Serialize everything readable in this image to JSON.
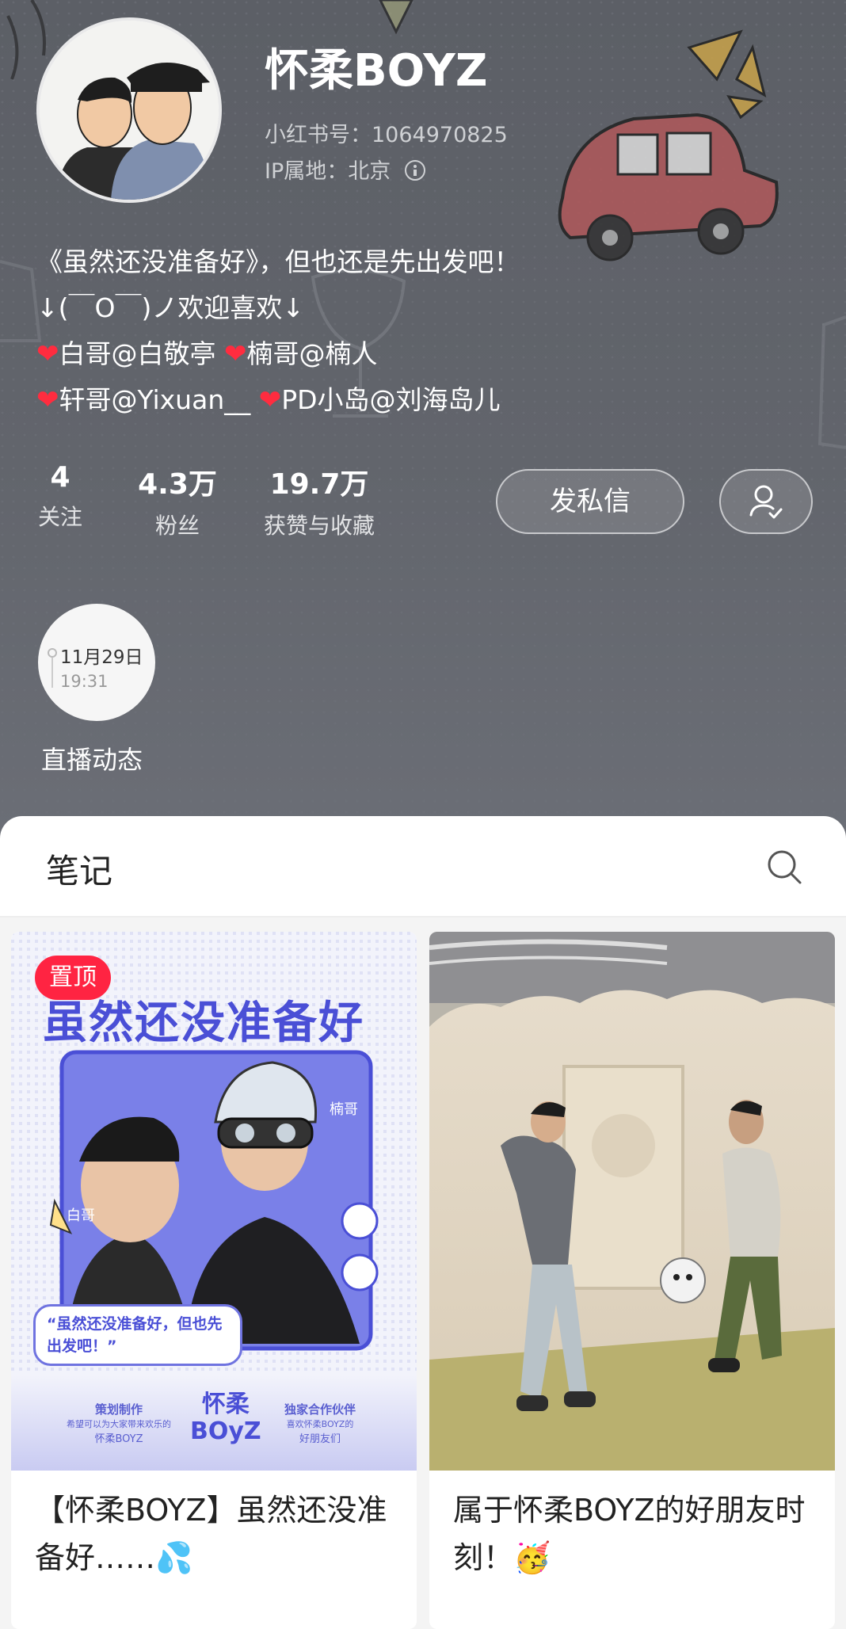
{
  "profile": {
    "nickname": "怀柔BOYZ",
    "red_id": "小红书号：1064970825",
    "ip": "IP属地：北京"
  },
  "bio": {
    "line1": "《虽然还没准备好》，但也还是先出发吧！",
    "line2": "↓(￣O￣)ノ欢迎喜欢↓",
    "line3a": "白哥@白敬亭",
    "line3b": "楠哥@楠人",
    "line4a": "轩哥@Yixuan__",
    "line4b": "PD小岛@刘海岛儿"
  },
  "stats": [
    {
      "value": "4",
      "label": "关注"
    },
    {
      "value": "4.3万",
      "label": "粉丝"
    },
    {
      "value": "19.7万",
      "label": "获赞与收藏"
    }
  ],
  "actions": {
    "message": "发私信"
  },
  "live": {
    "date": "11月29日",
    "time": "19:31",
    "label": "直播动态"
  },
  "notes_tab": {
    "title": "笔记"
  },
  "cards": [
    {
      "badge": "置顶",
      "title": "【怀柔BOYZ】虽然还没准备好……💦",
      "poster": {
        "headline": "虽然还没准备好",
        "quote": "“虽然还没准备好，但也先出发吧！”",
        "name_left": "白哥",
        "name_right": "楠哥",
        "footer_left_title": "策划制作",
        "footer_left_sub": "希望可以为大家带来欢乐的",
        "footer_left_name": "怀柔BOYZ",
        "footer_logo_top": "怀柔",
        "footer_logo_bottom": "BOyZ",
        "footer_right_title": "独家合作伙伴",
        "footer_right_sub": "喜欢怀柔BOYZ的",
        "footer_right_name": "好朋友们"
      }
    },
    {
      "title": "属于怀柔BOYZ的好朋友时刻！🥳"
    }
  ],
  "colors": {
    "header_bg": "#5f6269",
    "accent_red": "#ff2442",
    "poster_blue": "#4a4fd6"
  }
}
